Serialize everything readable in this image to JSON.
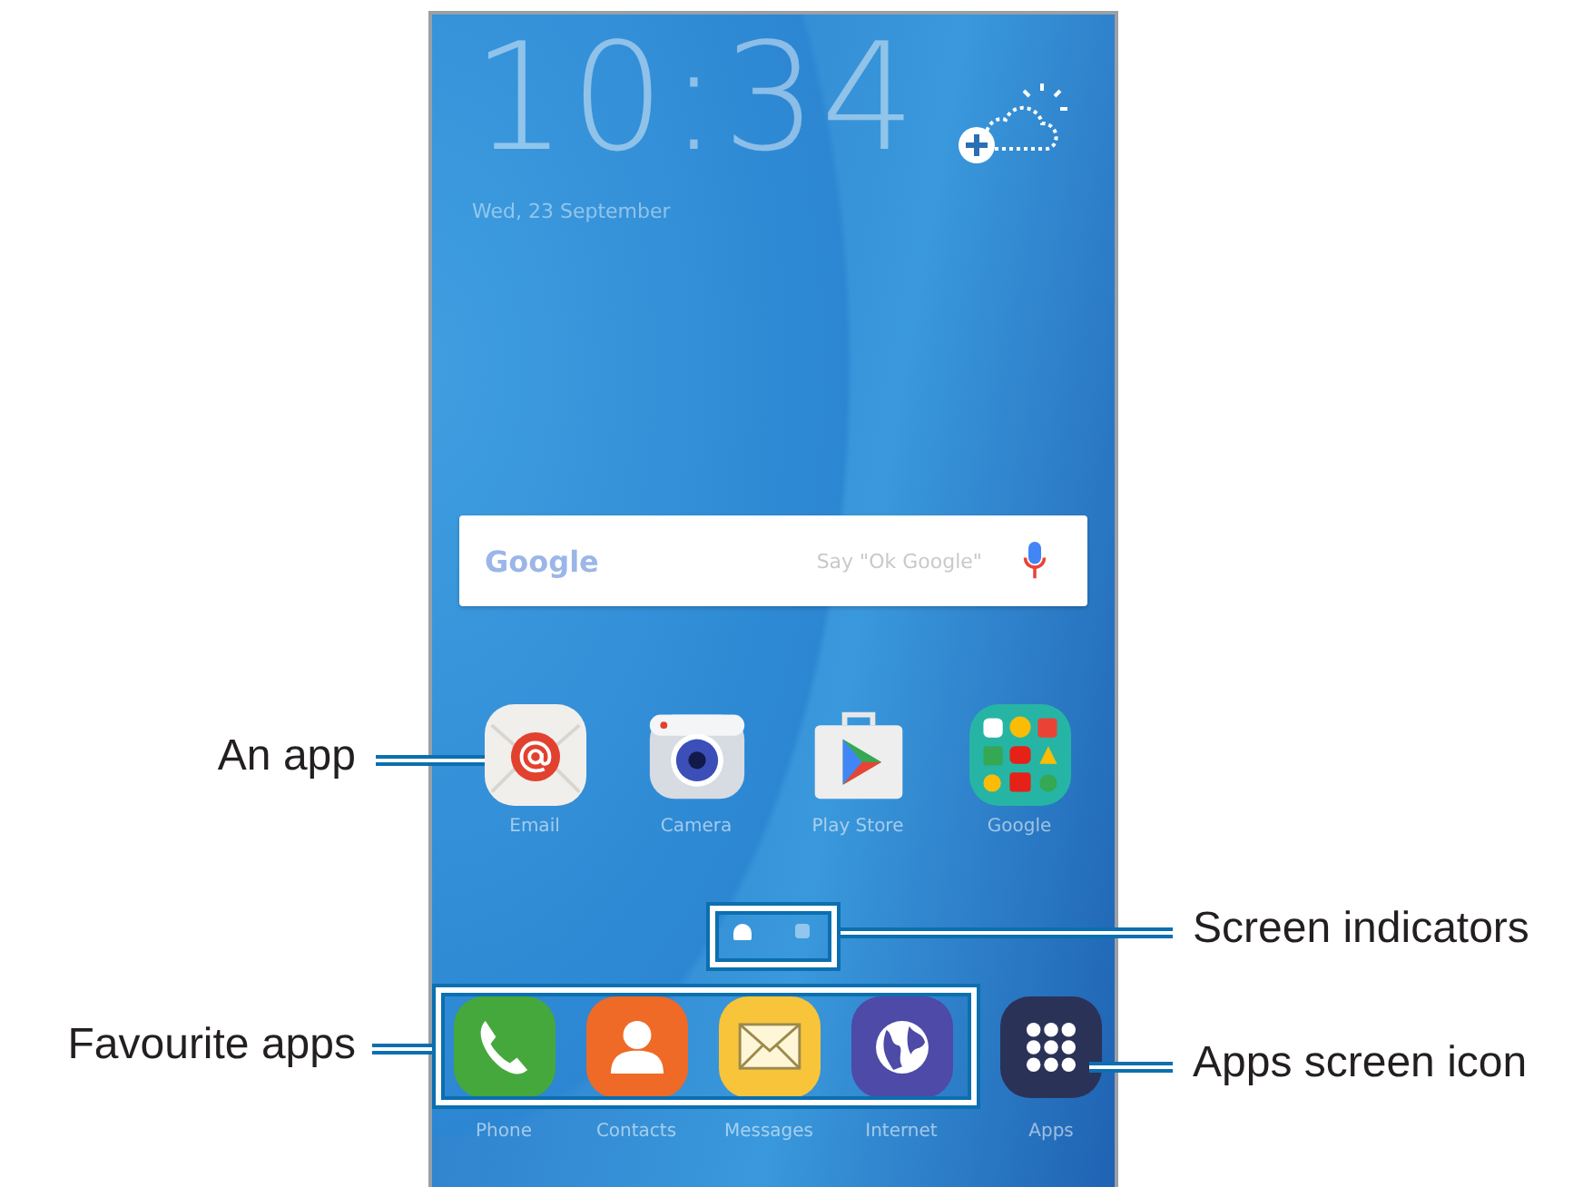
{
  "screen": {
    "clock": "10:34",
    "date": "Wed, 23 September",
    "search": {
      "logo": "Google",
      "placeholder": "Say \"Ok Google\""
    },
    "apps": [
      {
        "kind": "email",
        "label": "Email"
      },
      {
        "kind": "camera",
        "label": "Camera"
      },
      {
        "kind": "store",
        "label": "Play Store"
      },
      {
        "kind": "folder",
        "label": "Google"
      }
    ],
    "indicators": [
      {
        "kind": "home",
        "selected": true
      },
      {
        "kind": "dot",
        "selected": false
      }
    ],
    "favourites": [
      {
        "kind": "phone",
        "label": "Phone"
      },
      {
        "kind": "contacts",
        "label": "Contacts"
      },
      {
        "kind": "messages",
        "label": "Messages"
      },
      {
        "kind": "internet",
        "label": "Internet"
      }
    ],
    "apps_button": {
      "kind": "apps",
      "label": "Apps"
    }
  },
  "callouts": [
    {
      "text": "An app"
    },
    {
      "text": "Screen indicators"
    },
    {
      "text": "Favourite apps"
    },
    {
      "text": "Apps screen icon"
    }
  ]
}
